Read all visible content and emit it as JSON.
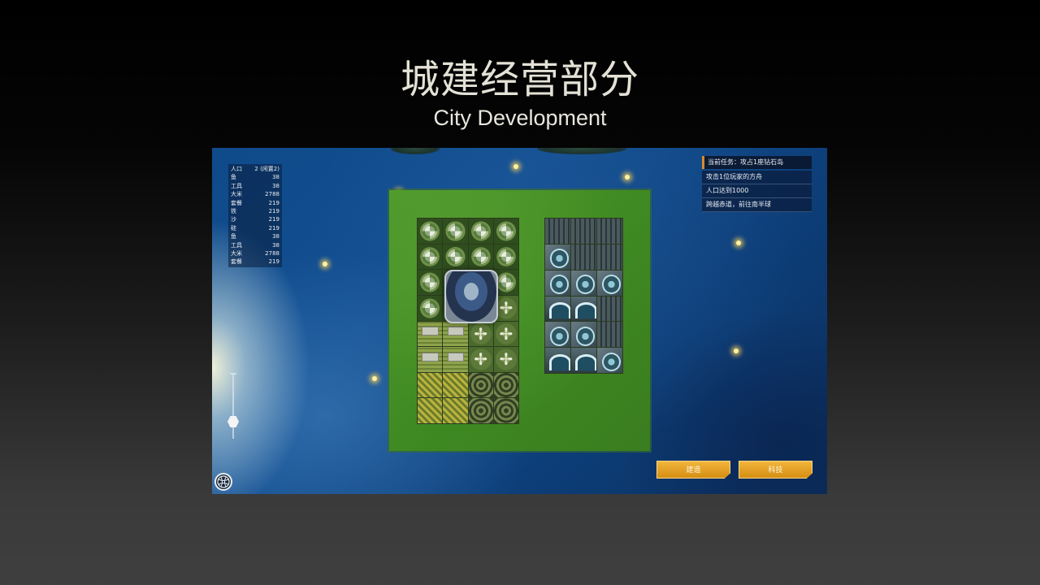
{
  "slide": {
    "title": "城建经营部分",
    "subtitle": "City Development"
  },
  "game": {
    "resources": [
      {
        "name": "人口",
        "value": "2 (闲置2)"
      },
      {
        "name": "鱼",
        "value": "38"
      },
      {
        "name": "工具",
        "value": "38"
      },
      {
        "name": "大米",
        "value": "2788"
      },
      {
        "name": "套餐",
        "value": "219"
      },
      {
        "name": "铁",
        "value": "219"
      },
      {
        "name": "沙",
        "value": "219"
      },
      {
        "name": "硅",
        "value": "219"
      },
      {
        "name": "鱼",
        "value": "38"
      },
      {
        "name": "工具",
        "value": "38"
      },
      {
        "name": "大米",
        "value": "2788"
      },
      {
        "name": "套餐",
        "value": "219"
      }
    ],
    "tasks": {
      "header": "当前任务：攻占1座钻石岛",
      "items": [
        "攻击1位玩家的方舟",
        "人口达到1000",
        "跨越赤道，前往南半球"
      ]
    },
    "buttons": {
      "build": "建造",
      "tech": "科技"
    },
    "icons": {
      "globe": "globe-icon",
      "zoom": "zoom-slider"
    },
    "colors": {
      "button": "#e3a126",
      "task_accent": "#d88a2a",
      "ocean": "#0f4a8a",
      "island": "#4a922a"
    }
  }
}
